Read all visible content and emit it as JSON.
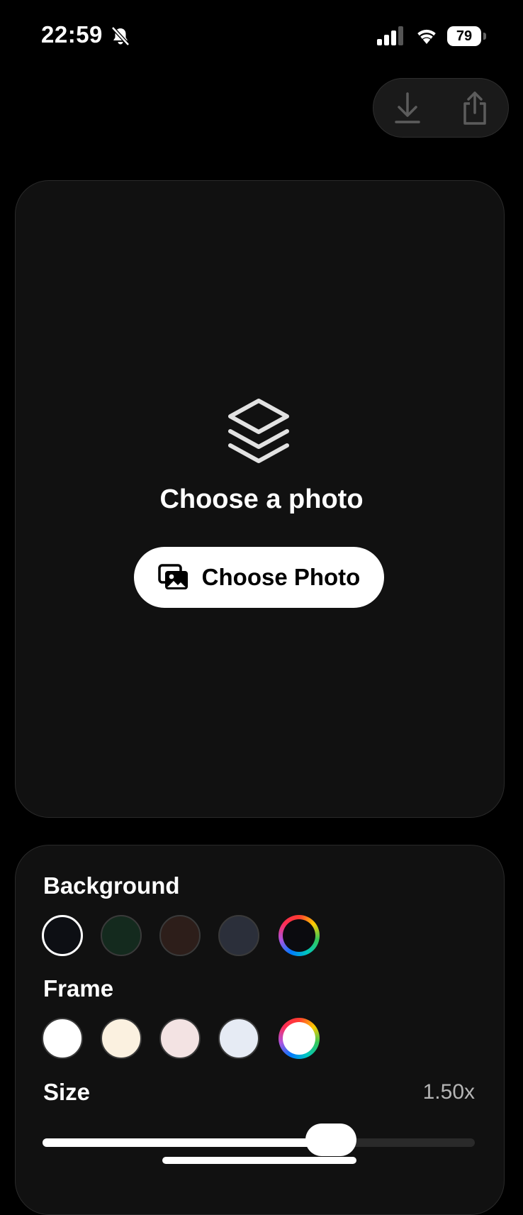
{
  "status_bar": {
    "time": "22:59",
    "battery_level": "79",
    "icons": [
      "bell-slash-icon",
      "cellular-signal-icon",
      "wifi-icon",
      "battery-icon"
    ]
  },
  "toolbar": {
    "download_icon": "download-icon",
    "share_icon": "share-icon"
  },
  "preview": {
    "icon": "layers-icon",
    "title": "Choose a photo",
    "button_label": "Choose Photo",
    "button_icon": "photos-icon"
  },
  "controls": {
    "background": {
      "label": "Background",
      "swatches": [
        "#0d0f14",
        "#142a1e",
        "#2d1e1a",
        "#2b2f3a",
        "custom"
      ],
      "selected_index": 0,
      "custom_inner": "#0b0b0f"
    },
    "frame": {
      "label": "Frame",
      "swatches": [
        "#ffffff",
        "#fbf1e0",
        "#f3e3e3",
        "#e6ebf4",
        "custom"
      ],
      "custom_inner": "#ffffff"
    },
    "size": {
      "label": "Size",
      "value_text": "1.50x",
      "slider_fraction": 0.667
    }
  },
  "colors": {
    "background": "#000000",
    "card": "#111111",
    "accent": "#ffffff"
  }
}
